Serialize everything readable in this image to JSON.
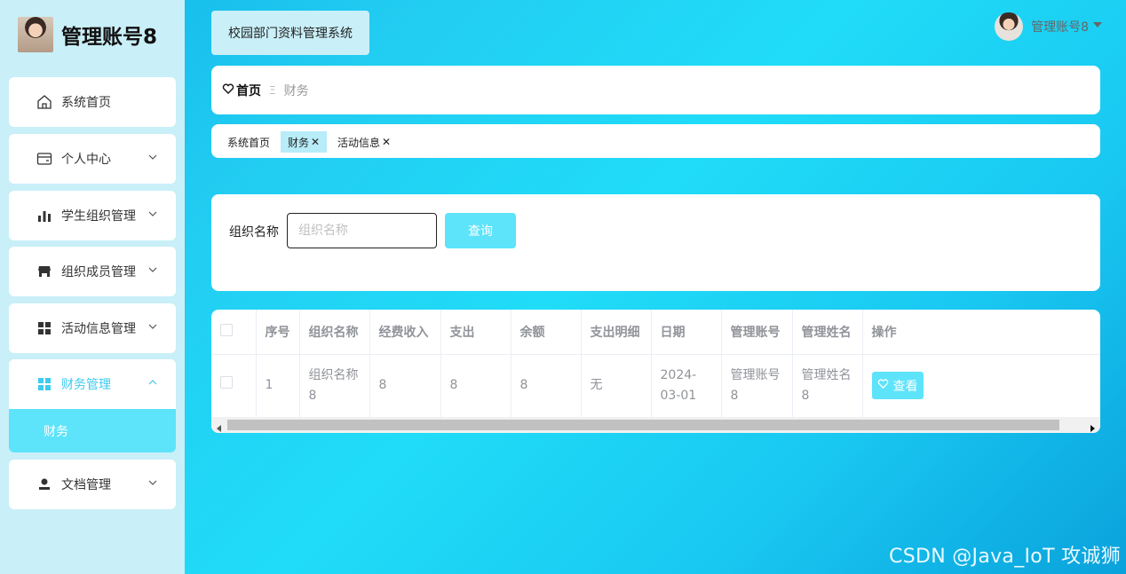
{
  "brand": {
    "title": "管理账号8"
  },
  "sidebar": {
    "items": [
      {
        "label": "系统首页",
        "icon": "home-icon"
      },
      {
        "label": "个人中心",
        "icon": "card-icon"
      },
      {
        "label": "学生组织管理",
        "icon": "bar-chart-icon"
      },
      {
        "label": "组织成员管理",
        "icon": "shop-icon"
      },
      {
        "label": "活动信息管理",
        "icon": "grid-icon"
      },
      {
        "label": "财务管理",
        "icon": "grid-icon"
      },
      {
        "label": "文档管理",
        "icon": "user-icon"
      }
    ],
    "active_sub": "财务"
  },
  "header": {
    "system_title": "校园部门资料管理系统",
    "user_name": "管理账号8"
  },
  "breadcrumb": {
    "home": "首页",
    "current": "财务"
  },
  "tags": [
    {
      "label": "系统首页"
    },
    {
      "label": "财务"
    },
    {
      "label": "活动信息"
    }
  ],
  "search": {
    "label": "组织名称",
    "placeholder": "组织名称",
    "button": "查询"
  },
  "table": {
    "columns": [
      "序号",
      "组织名称",
      "经费收入",
      "支出",
      "余额",
      "支出明细",
      "日期",
      "管理账号",
      "管理姓名",
      "操作"
    ],
    "rows": [
      {
        "index": "1",
        "org_name": "组织名称8",
        "income": "8",
        "expense": "8",
        "balance": "8",
        "detail": "无",
        "date": "2024-03-01",
        "account": "管理账号8",
        "manager": "管理姓名8",
        "action": "查看"
      }
    ]
  },
  "watermark": "CSDN @Java_IoT 攻诚狮",
  "colors": {
    "accent": "#5de3fa",
    "sidebar_bg": "#c9eff8",
    "active_text": "#3ecbf0"
  }
}
